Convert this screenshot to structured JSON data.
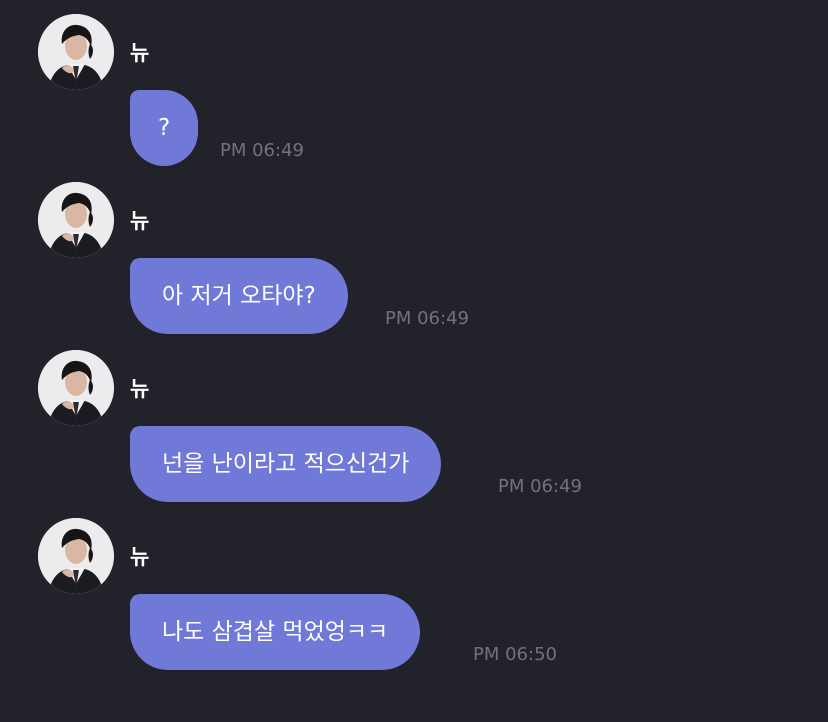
{
  "messages": [
    {
      "sender": "뉴",
      "text": "?",
      "time": "PM 06:49"
    },
    {
      "sender": "뉴",
      "text": "아 저거 오타야?",
      "time": "PM 06:49"
    },
    {
      "sender": "뉴",
      "text": "넌을 난이라고 적으신건가",
      "time": "PM 06:49"
    },
    {
      "sender": "뉴",
      "text": "나도 삼겹살 먹었엉ㅋㅋ",
      "time": "PM 06:50"
    }
  ],
  "colors": {
    "background": "#22222b",
    "bubble": "#7078d8",
    "time_text": "#717182",
    "text": "#ffffff"
  },
  "icons": {
    "avatar": "profile-photo-avatar"
  }
}
